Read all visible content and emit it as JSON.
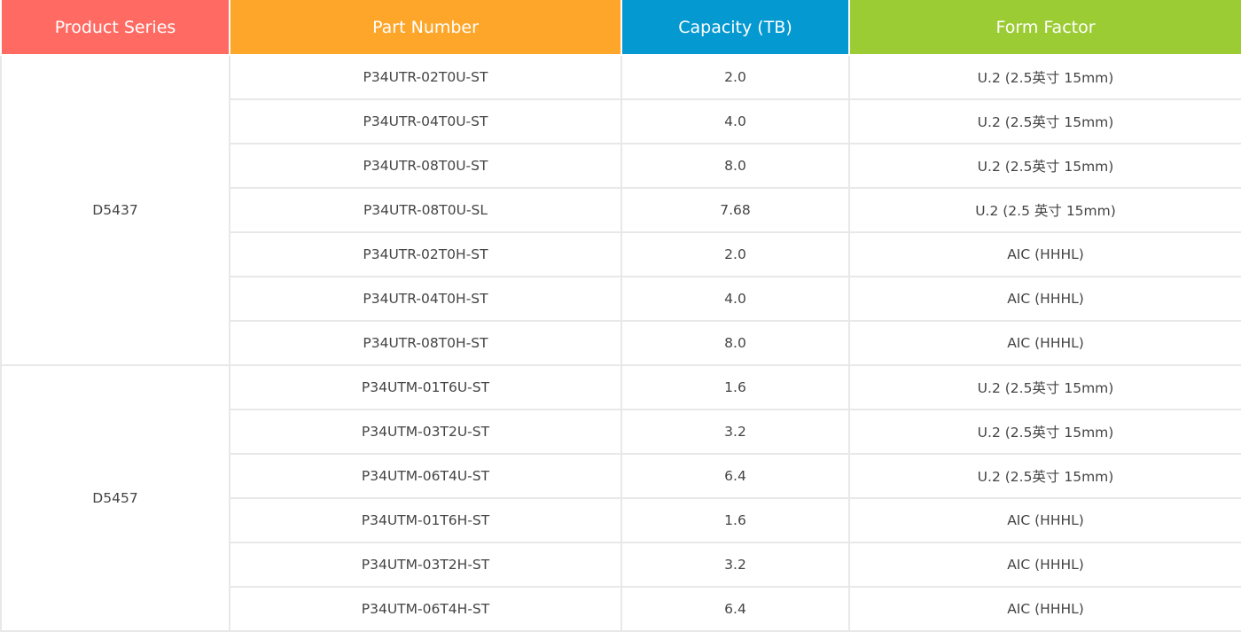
{
  "header": {
    "columns": [
      {
        "label": "Product Series",
        "color": "#ff6b63"
      },
      {
        "label": "Part Number",
        "color": "#fda62a"
      },
      {
        "label": "Capacity (TB)",
        "color": "#0599d2"
      },
      {
        "label": "Form Factor",
        "color": "#9ccc34"
      }
    ]
  },
  "groups": [
    {
      "series": "D5437",
      "rows": [
        {
          "part": "P34UTR-02T0U-ST",
          "capacity": "2.0",
          "form": "U.2 (2.5英寸 15mm)"
        },
        {
          "part": "P34UTR-04T0U-ST",
          "capacity": "4.0",
          "form": "U.2 (2.5英寸 15mm)"
        },
        {
          "part": "P34UTR-08T0U-ST",
          "capacity": "8.0",
          "form": "U.2 (2.5英寸 15mm)"
        },
        {
          "part": "P34UTR-08T0U-SL",
          "capacity": "7.68",
          "form": "U.2 (2.5 英寸 15mm)"
        },
        {
          "part": "P34UTR-02T0H-ST",
          "capacity": "2.0",
          "form": "AIC (HHHL)"
        },
        {
          "part": "P34UTR-04T0H-ST",
          "capacity": "4.0",
          "form": "AIC (HHHL)"
        },
        {
          "part": "P34UTR-08T0H-ST",
          "capacity": "8.0",
          "form": "AIC (HHHL)"
        }
      ]
    },
    {
      "series": "D5457",
      "rows": [
        {
          "part": "P34UTM-01T6U-ST",
          "capacity": "1.6",
          "form": "U.2 (2.5英寸 15mm)"
        },
        {
          "part": "P34UTM-03T2U-ST",
          "capacity": "3.2",
          "form": "U.2 (2.5英寸 15mm)"
        },
        {
          "part": "P34UTM-06T4U-ST",
          "capacity": "6.4",
          "form": "U.2 (2.5英寸 15mm)"
        },
        {
          "part": "P34UTM-01T6H-ST",
          "capacity": "1.6",
          "form": "AIC (HHHL)"
        },
        {
          "part": "P34UTM-03T2H-ST",
          "capacity": "3.2",
          "form": "AIC (HHHL)"
        },
        {
          "part": "P34UTM-06T4H-ST",
          "capacity": "6.4",
          "form": "AIC (HHHL)"
        }
      ]
    }
  ]
}
